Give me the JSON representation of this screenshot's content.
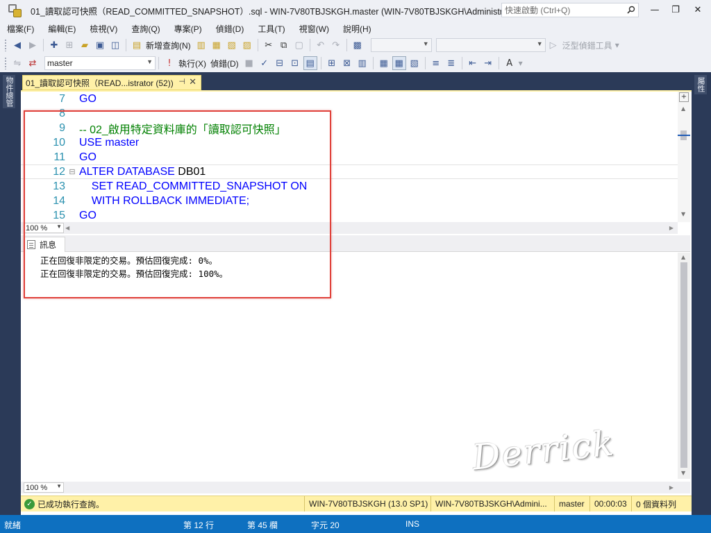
{
  "window": {
    "title": "01_讀取認可快照（READ_COMMITTED_SNAPSHOT）.sql - WIN-7V80TBJSKGH.master (WIN-7V80TBJSKGH\\Administrat...",
    "quick_launch_placeholder": "快速啟動 (Ctrl+Q)",
    "minimize": "—",
    "restore": "❐",
    "close": "✕"
  },
  "menu": [
    "檔案(F)",
    "編輯(E)",
    "檢視(V)",
    "查詢(Q)",
    "專案(P)",
    "偵錯(D)",
    "工具(T)",
    "視窗(W)",
    "說明(H)"
  ],
  "toolbar1": {
    "new_query": "新增查詢(N)",
    "generic_debugger": "泛型偵錯工具"
  },
  "toolbar2": {
    "database": "master",
    "execute": "執行(X)",
    "debug": "偵錯(D)"
  },
  "side": {
    "left_tab": "物件總管",
    "right_tab": "屬性"
  },
  "doc_tab": {
    "label": "01_讀取認可快照（READ...istrator (52))",
    "pin": "⊣",
    "close": "✕"
  },
  "editor": {
    "lines": [
      {
        "num": "7",
        "parts": [
          {
            "t": "GO",
            "c": "kw"
          }
        ]
      },
      {
        "num": "8",
        "parts": []
      },
      {
        "num": "9",
        "parts": [
          {
            "t": "-- 02_啟用特定資料庫的「讀取認可快照」",
            "c": "cm"
          }
        ]
      },
      {
        "num": "10",
        "parts": [
          {
            "t": "USE master",
            "c": "kw"
          }
        ]
      },
      {
        "num": "11",
        "parts": [
          {
            "t": "GO",
            "c": "kw"
          }
        ]
      },
      {
        "num": "12",
        "fold": "⊟",
        "parts": [
          {
            "t": "ALTER DATABASE ",
            "c": "kw"
          },
          {
            "t": "DB01",
            "c": "plain"
          }
        ]
      },
      {
        "num": "13",
        "parts": [
          {
            "t": "    SET READ_COMMITTED_SNAPSHOT ON",
            "c": "kw"
          }
        ]
      },
      {
        "num": "14",
        "parts": [
          {
            "t": "    WITH ROLLBACK IMMEDIATE;",
            "c": "kw"
          }
        ]
      },
      {
        "num": "15",
        "parts": [
          {
            "t": "GO",
            "c": "kw"
          }
        ]
      }
    ],
    "zoom": "100 %"
  },
  "results": {
    "tab_label": "訊息",
    "messages": [
      "正在回復非限定的交易。預估回復完成: 0%。",
      "正在回復非限定的交易。預估回復完成: 100%。"
    ],
    "zoom": "100 %",
    "watermark": "Derrick"
  },
  "query_status": {
    "message": "已成功執行查詢。",
    "server": "WIN-7V80TBJSKGH (13.0 SP1)",
    "user": "WIN-7V80TBJSKGH\\Admini...",
    "database": "master",
    "elapsed": "00:00:03",
    "rows": "0 個資料列"
  },
  "status": {
    "ready": "就緒",
    "line": "第 12 行",
    "col": "第 45 欄",
    "ch": "字元 20",
    "mode": "INS"
  }
}
